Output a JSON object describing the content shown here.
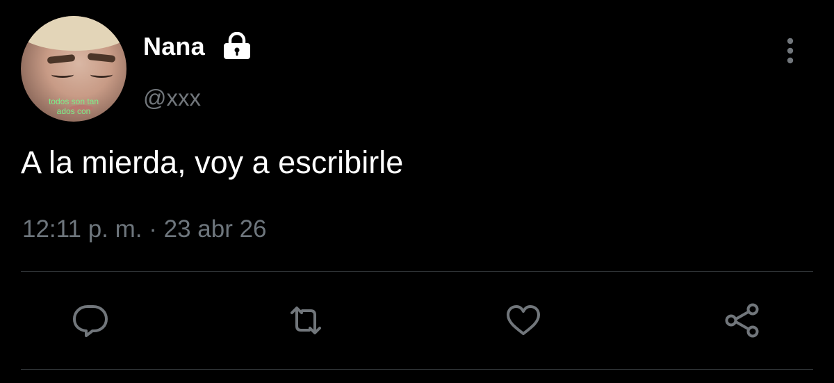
{
  "user": {
    "display_name": "Nana",
    "handle": "@xxx",
    "avatar_caption_line1": "todos son tan",
    "avatar_caption_line2": "ados con",
    "protected_icon": "lock-icon"
  },
  "tweet": {
    "text": "A la mierda, voy a escribirle",
    "timestamp": "12:11 p. m. · 23 abr 26"
  },
  "actions": {
    "reply_icon": "comment-bubble-icon",
    "retweet_icon": "retweet-icon",
    "like_icon": "heart-icon",
    "share_icon": "share-icon",
    "more_icon": "vertical-ellipsis-icon"
  },
  "colors": {
    "background": "#000000",
    "primary_text": "#ffffff",
    "secondary_text": "#71767b",
    "icon": "#71767b",
    "divider": "#2f3336"
  }
}
